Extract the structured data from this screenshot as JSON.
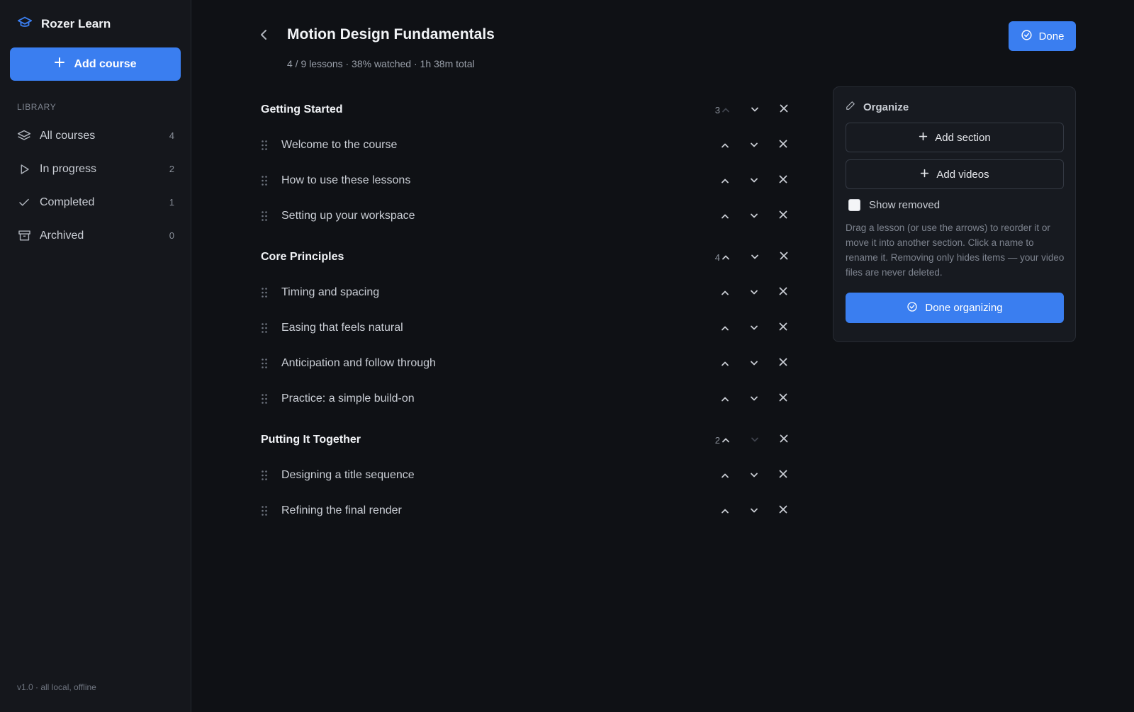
{
  "app": {
    "name": "Rozer Learn",
    "logo_icon": "graduation-cap-icon",
    "accent": "#3a7ef0"
  },
  "sidebar": {
    "add_course_label": "Add course",
    "library_label": "LIBRARY",
    "items": [
      {
        "label": "All courses",
        "count": "4",
        "icon": "layers-icon"
      },
      {
        "label": "In progress",
        "count": "2",
        "icon": "play-icon"
      },
      {
        "label": "Completed",
        "count": "1",
        "icon": "check-icon"
      },
      {
        "label": "Archived",
        "count": "0",
        "icon": "archive-icon"
      }
    ],
    "version": "v1.0 · all local, offline"
  },
  "header": {
    "title": "Motion Design Fundamentals",
    "meta": "4 / 9 lessons · 38% watched · 1h 38m total",
    "done_label": "Done"
  },
  "sections": [
    {
      "title": "Getting Started",
      "count": "3",
      "up_disabled": true,
      "down_disabled": false,
      "lessons": [
        "Welcome to the course",
        "How to use these lessons",
        "Setting up your workspace"
      ]
    },
    {
      "title": "Core Principles",
      "count": "4",
      "up_disabled": false,
      "down_disabled": false,
      "lessons": [
        "Timing and spacing",
        "Easing that feels natural",
        "Anticipation and follow through",
        "Practice: a simple build-on"
      ]
    },
    {
      "title": "Putting It Together",
      "count": "2",
      "up_disabled": false,
      "down_disabled": true,
      "lessons": [
        "Designing a title sequence",
        "Refining the final render"
      ]
    }
  ],
  "organize": {
    "title": "Organize",
    "add_section_label": "Add section",
    "add_videos_label": "Add videos",
    "show_removed_label": "Show removed",
    "show_removed_checked": false,
    "help_text": "Drag a lesson (or use the arrows) to reorder it or move it into another section. Click a name to rename it. Removing only hides items — your video files are never deleted.",
    "done_label": "Done organizing"
  }
}
